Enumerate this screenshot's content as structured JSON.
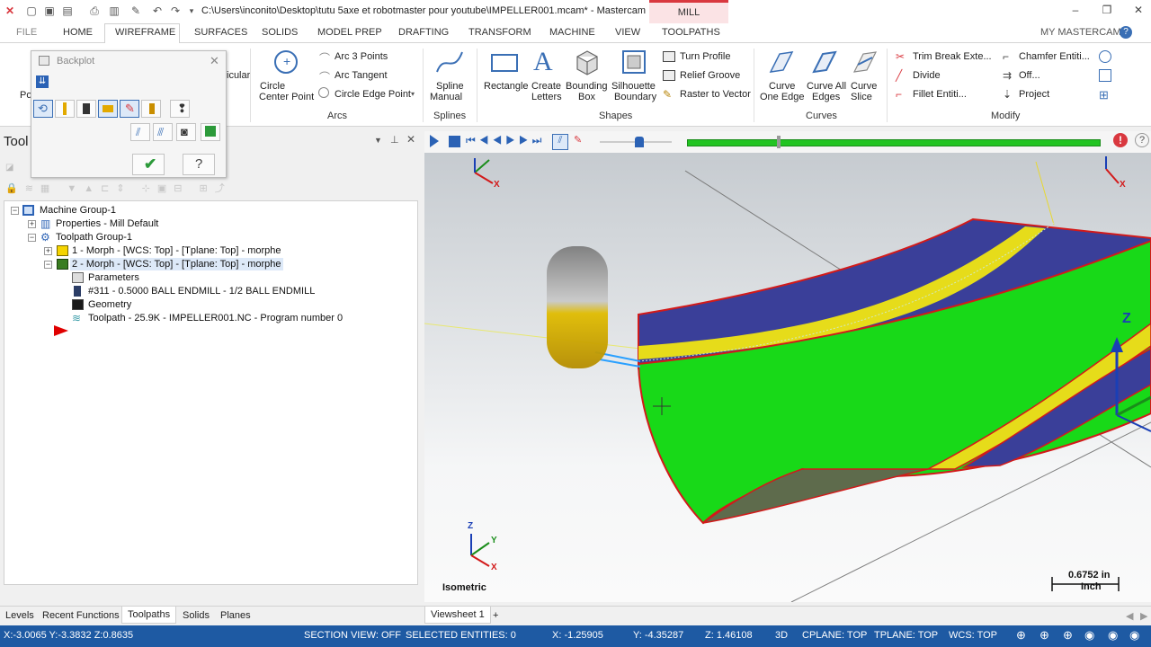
{
  "window": {
    "title": "C:\\Users\\inconito\\Desktop\\tutu 5axe et robotmaster pour youtube\\IMPELLER001.mcam* - Mastercam ...",
    "context_tab": "MILL"
  },
  "menu": {
    "file": "FILE",
    "home": "HOME",
    "wireframe": "WIREFRAME",
    "surfaces": "SURFACES",
    "solids": "SOLIDS",
    "model_prep": "MODEL PREP",
    "drafting": "DRAFTING",
    "transform": "TRANSFORM",
    "machine": "MACHINE",
    "view": "VIEW",
    "toolpaths": "TOOLPATHS",
    "my_mastercam": "MY MASTERCAM"
  },
  "ribbon": {
    "points_partial": "Po",
    "points_partial2": "Positi",
    "perpendicular_partial": "icular",
    "circle_center_point": "Circle\nCenter Point",
    "circle_center_1": "Circle",
    "circle_center_2": "Center Point",
    "arc_3_points": "Arc 3 Points",
    "arc_tangent": "Arc Tangent",
    "circle_edge_point": "Circle Edge Point",
    "arcs_group": "Arcs",
    "spline_1": "Spline",
    "spline_2": "Manual",
    "splines_group": "Splines",
    "rectangle": "Rectangle",
    "create_letters_1": "Create",
    "create_letters_2": "Letters",
    "bounding_box_1": "Bounding",
    "bounding_box_2": "Box",
    "silhouette_1": "Silhouette",
    "silhouette_2": "Boundary",
    "turn_profile": "Turn Profile",
    "relief_groove": "Relief Groove",
    "raster_to_vector": "Raster to Vector",
    "shapes_group": "Shapes",
    "curve_one_edge_1": "Curve",
    "curve_one_edge_2": "One Edge",
    "curve_all_edges_1": "Curve All",
    "curve_all_edges_2": "Edges",
    "curve_slice_1": "Curve",
    "curve_slice_2": "Slice",
    "curves_group": "Curves",
    "trim_break": "Trim Break Exte...",
    "chamfer": "Chamfer Entiti...",
    "divide": "Divide",
    "offset": "Off...",
    "fillet": "Fillet Entiti...",
    "project": "Project",
    "modify_group": "Modify"
  },
  "backplot": {
    "title": "Backplot"
  },
  "toolpath_panel": {
    "title": "Tool",
    "tree": {
      "machine_group": "Machine Group-1",
      "properties": "Properties - Mill Default",
      "toolpath_group": "Toolpath Group-1",
      "op1": "1 - Morph - [WCS: Top] - [Tplane: Top] - morphe",
      "op2": "2 - Morph - [WCS: Top] - [Tplane: Top] - morphe",
      "parameters": "Parameters",
      "tool": "#311 - 0.5000 BALL ENDMILL - 1/2 BALL ENDMILL",
      "geometry": "Geometry",
      "toolpath": "Toolpath - 25.9K - IMPELLER001.NC - Program number 0"
    }
  },
  "viewport": {
    "view_name": "Isometric",
    "scale_value": "0.6752 in",
    "scale_unit": "Inch",
    "axis_x": "X",
    "axis_y": "Y",
    "axis_z": "Z"
  },
  "bottom_tabs": {
    "levels": "Levels",
    "recent": "Recent Functions",
    "toolpaths": "Toolpaths",
    "solids": "Solids",
    "planes": "Planes",
    "viewsheet": "Viewsheet 1",
    "add": "+"
  },
  "status": {
    "coords_left": "X:-3.0065  Y:-3.3832  Z:0.8635",
    "section_view": "SECTION VIEW: OFF",
    "selected": "SELECTED ENTITIES: 0",
    "x": "X:   -1.25905",
    "y": "Y:   -4.35287",
    "z": "Z:   1.46108",
    "mode": "3D",
    "cplane": "CPLANE: TOP",
    "tplane": "TPLANE: TOP",
    "wcs": "WCS: TOP"
  }
}
